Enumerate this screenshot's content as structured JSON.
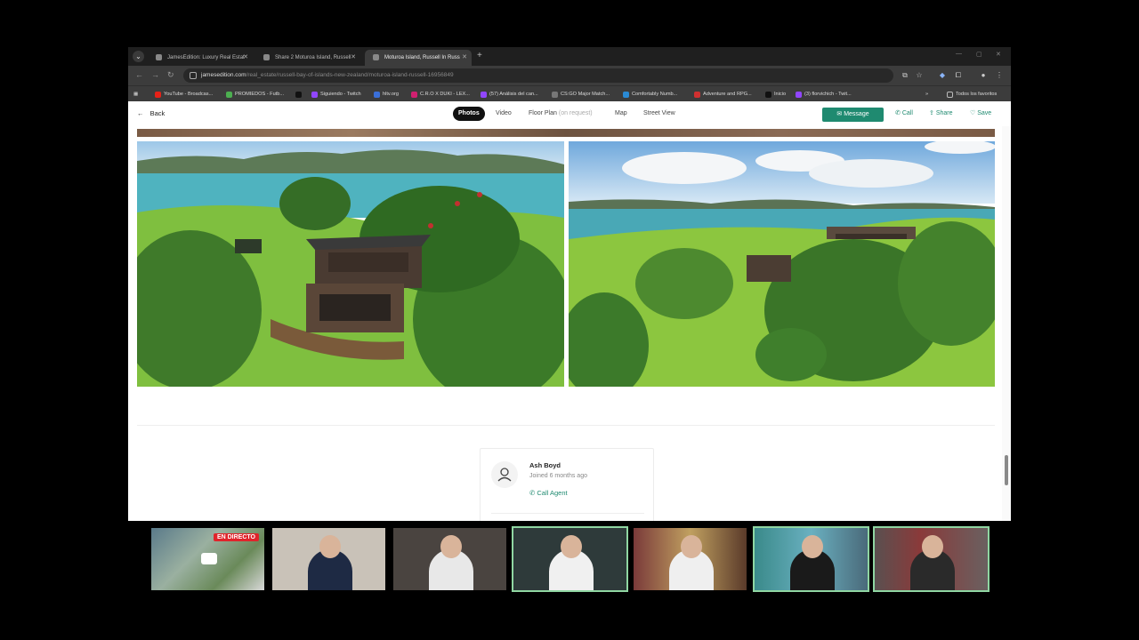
{
  "browser": {
    "tabs": [
      {
        "title": "JamesEdition: Luxury Real Estat",
        "active": false
      },
      {
        "title": "Share 2 Moturoa Island, Russell",
        "active": false
      },
      {
        "title": "Moturoa Island, Russell In Russ",
        "active": true
      }
    ],
    "new_tab": "+",
    "url_domain": "jamesedition.com",
    "url_path": "/real_estate/russell-bay-of-islands-new-zealand/moturoa-island-russell-16956849",
    "bookmarks": [
      {
        "label": "YouTube - Broadcas...",
        "color": "#e62117"
      },
      {
        "label": "PROMIEDOS - Futb...",
        "color": "#4caf50"
      },
      {
        "label": "",
        "color": "#111111"
      },
      {
        "label": "Siguiendo - Twitch",
        "color": "#9146ff"
      },
      {
        "label": "hltv.org",
        "color": "#3a6fd8"
      },
      {
        "label": "C.R.O X DUKI - LEX...",
        "color": "#d02070"
      },
      {
        "label": "(57) Análisis del can...",
        "color": "#9146ff"
      },
      {
        "label": "CS:GO Major Match...",
        "color": "#777777"
      },
      {
        "label": "Comfortably Numb...",
        "color": "#2a8ad4"
      },
      {
        "label": "Adventure and RPG...",
        "color": "#d03030"
      },
      {
        "label": "Inicio",
        "color": "#111111"
      },
      {
        "label": "(3) florvichich - Twit...",
        "color": "#9146ff"
      }
    ],
    "all_bookmarks": "Todos los favoritos"
  },
  "page": {
    "back_label": "Back",
    "tabs": [
      {
        "label": "Photos",
        "active": true
      },
      {
        "label": "Video",
        "active": false
      },
      {
        "label": "Floor Plan",
        "note": "(on request)",
        "active": false
      },
      {
        "label": "Map",
        "active": false
      },
      {
        "label": "Street View",
        "active": false
      }
    ],
    "message_label": "Message",
    "call_label": "Call",
    "share_label": "Share",
    "save_label": "Save"
  },
  "agent": {
    "name": "Ash Boyd",
    "joined": "Joined 6 months ago",
    "call_label": "Call Agent"
  },
  "stream": {
    "live_label": "EN DIRECTO"
  },
  "colors": {
    "accent": "#1f8a70",
    "live": "#e0242b"
  }
}
